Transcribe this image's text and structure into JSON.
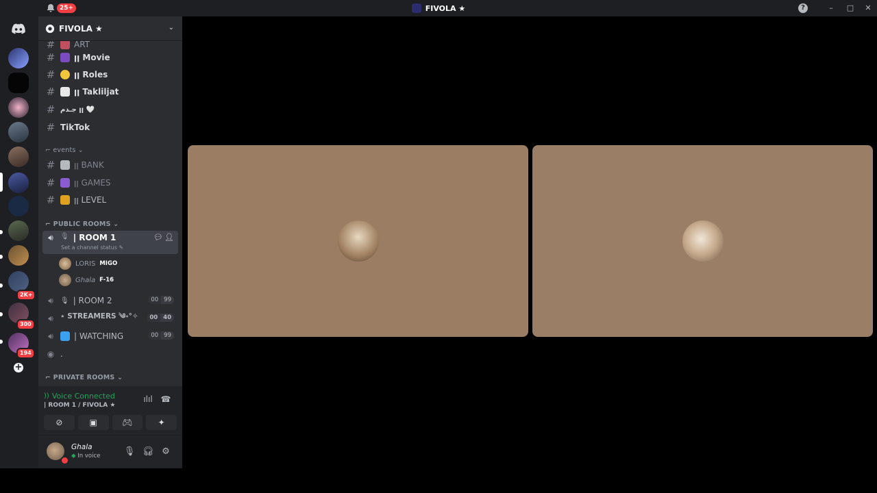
{
  "titlebar": {
    "notification_count": "25+",
    "server_name": "FIVOLA ★",
    "help": "?",
    "minimize": "–",
    "maximize": "□",
    "close": "✕"
  },
  "rail": {
    "badges": [
      "2K+",
      "300",
      "194"
    ],
    "add_server": "+"
  },
  "guild": {
    "name": "FIVOLA ★",
    "chevron": "⌄"
  },
  "channels": {
    "partial_top": "ART",
    "text_top": [
      {
        "name": "ꞁꞁ Movie"
      },
      {
        "name": "ꞁꞁ Roles"
      },
      {
        "name": "ꞁꞁ Takliljat"
      },
      {
        "name": "جـدم ꞁꞁ 🤍"
      },
      {
        "name": "TikTok"
      }
    ],
    "events_label": "⌐ events ⌄",
    "events": [
      {
        "name": "ꞁꞁ BANK"
      },
      {
        "name": "ꞁꞁ GAMES"
      },
      {
        "name": "ꞁꞁ LEVEL"
      }
    ],
    "public_label": "⌐ PUBLIC ROOMS ⌄",
    "room1": {
      "name": "| ROOM 1",
      "status": "Set a channel status ✎"
    },
    "members": [
      {
        "name": "LORIS",
        "tag": "MIGO"
      },
      {
        "name": "Ghala",
        "tag": "F-16"
      }
    ],
    "voice_rooms": [
      {
        "name": "| ROOM 2",
        "count_a": "00",
        "count_b": "99"
      },
      {
        "name": "⋆ STREAMERS ༄˖°✧",
        "count_a": "00",
        "count_b": "40"
      },
      {
        "name": "| WATCHING",
        "count_a": "00",
        "count_b": "99"
      }
    ],
    "stage_name": ".",
    "private_label": "⌐ PRIVATE ROOMS ⌄"
  },
  "voice": {
    "status": "Voice Connected",
    "room": "| ROOM 1 / FIVOLA ★"
  },
  "user": {
    "name": "Ghala",
    "status": "In voice"
  },
  "colors": {
    "accent_green": "#23a55a",
    "badge_red": "#f23f43",
    "sidebar": "#2b2d31",
    "tile": "#9a7d62"
  }
}
